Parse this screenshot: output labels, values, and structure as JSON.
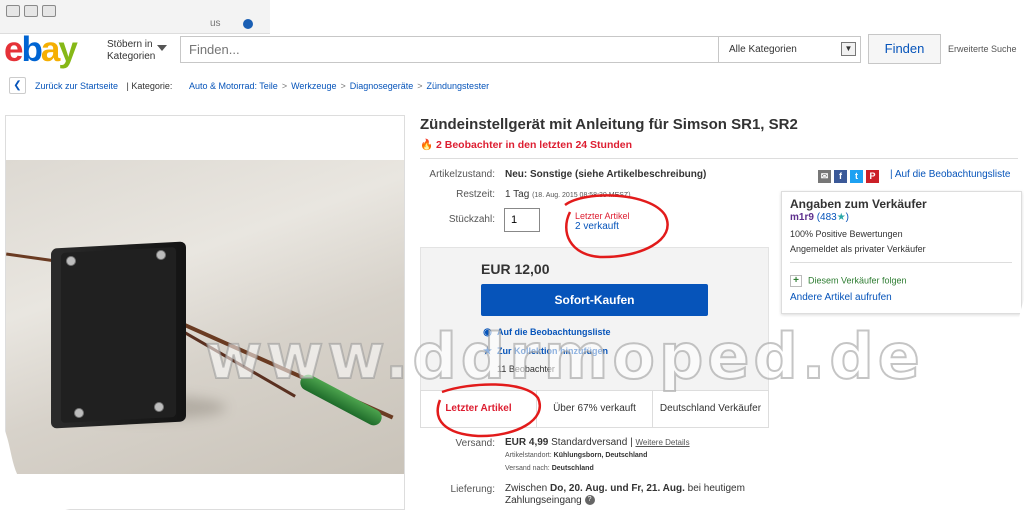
{
  "browser": {
    "partial_text": "us"
  },
  "header": {
    "logo": {
      "e": "e",
      "b": "b",
      "a": "a",
      "y": "y",
      "colors": [
        "#e53238",
        "#0064d2",
        "#f5af02",
        "#86b817"
      ]
    },
    "browse_label_1": "Stöbern in",
    "browse_label_2": "Kategorien",
    "search_placeholder": "Finden...",
    "category_selected": "Alle Kategorien",
    "search_button": "Finden",
    "advanced_link": "Erweiterte Suche"
  },
  "breadcrumb": {
    "back_label": "Zurück zur Startseite",
    "category_label": "| Kategorie:",
    "items": [
      "Auto & Motorrad: Teile",
      "Werkzeuge",
      "Diagnosegeräte",
      "Zündungstester"
    ]
  },
  "product": {
    "title": "Zündeinstellgerät mit Anleitung für Simson SR1, SR2",
    "hot_watchers": "2 Beobachter in den letzten 24 Stunden",
    "condition_label": "Artikelzustand:",
    "condition_value": "Neu: Sonstige (siehe Artikelbeschreibung)",
    "time_label": "Restzeit:",
    "time_value": "1 Tag",
    "time_detail": "(18. Aug. 2015  08:58:30 MESZ)",
    "qty_label": "Stückzahl:",
    "qty_value": "1",
    "last_article": "Letzter Artikel",
    "sold": "2 verkauft",
    "price": "EUR 12,00",
    "buy_button": "Sofort-Kaufen",
    "add_watchlist": "Auf die Beobachtungsliste",
    "add_collection": "Zur Kollektion hinzufügen",
    "watchers": "11 Beobachter"
  },
  "share": {
    "watchlist_link": "| Auf die Beobachtungsliste"
  },
  "stats": {
    "last": "Letzter Artikel",
    "sold_pct": "Über 67% verkauft",
    "seller_loc": "Deutschland Verkäufer"
  },
  "shipping": {
    "label": "Versand:",
    "price": "EUR 4,99",
    "method": "Standardversand |",
    "details_link": "Weitere Details",
    "location_label": "Artikelstandort:",
    "location_value": "Kühlungsborn, Deutschland",
    "ship_to_label": "Versand nach:",
    "ship_to_value": "Deutschland",
    "delivery_label": "Lieferung:",
    "delivery_prefix": "Zwischen",
    "delivery_dates": "Do, 20. Aug. und Fr, 21. Aug.",
    "delivery_suffix": "bei heutigem Zahlungseingang"
  },
  "seller": {
    "title": "Angaben zum Verkäufer",
    "name": "m1r9",
    "score": "(483",
    "star": "★",
    "close": ")",
    "positive": "100% Positive Bewertungen",
    "type": "Angemeldet als privater Verkäufer",
    "follow": "Diesem Verkäufer folgen",
    "other_items": "Andere Artikel aufrufen"
  },
  "watermark": "www.ddrmoped.de",
  "colors": {
    "ebay_blue": "#0654ba",
    "red": "#dd1e31",
    "buy_box_bg": "#f3f3f3"
  }
}
